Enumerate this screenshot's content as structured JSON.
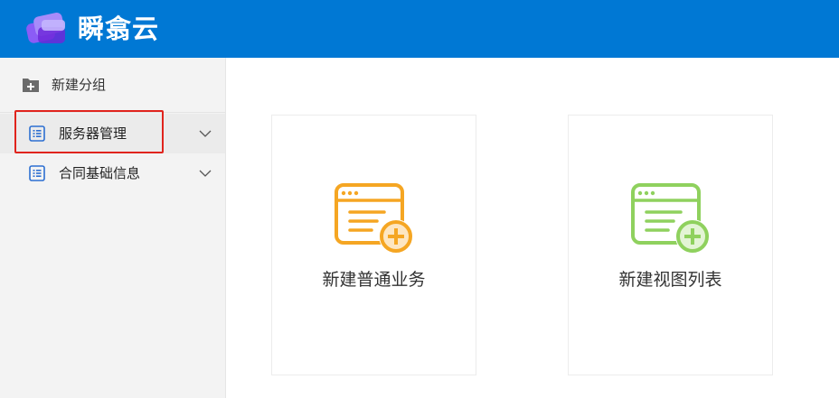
{
  "header": {
    "brand": "瞬翕云",
    "logo_icon": "app-logo-icon",
    "bg_color": "#0078d4"
  },
  "sidebar": {
    "new_group": {
      "label": "新建分组",
      "icon": "folder-plus-icon"
    },
    "items": [
      {
        "label": "服务器管理",
        "icon": "list-icon",
        "expanded": false,
        "highlighted": true
      },
      {
        "label": "合同基础信息",
        "icon": "list-icon",
        "expanded": false,
        "highlighted": false
      }
    ]
  },
  "cards": [
    {
      "label": "新建普通业务",
      "icon": "window-add-icon",
      "color": "#f5a623"
    },
    {
      "label": "新建视图列表",
      "icon": "window-add-icon",
      "color": "#8fd15e"
    }
  ],
  "accent_color": "#2d6fd1",
  "highlight_color": "#e0241d"
}
